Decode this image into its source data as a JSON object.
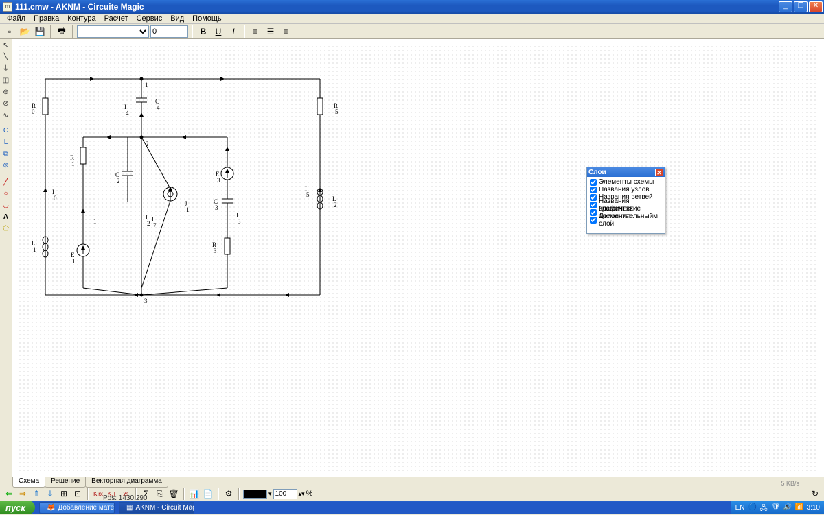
{
  "title": "111.cmw - AKNM - Circuite Magic",
  "menu": [
    "Файл",
    "Правка",
    "Контура",
    "Расчет",
    "Сервис",
    "Вид",
    "Помощь"
  ],
  "toolbar": {
    "font_value": "",
    "size_value": "0"
  },
  "layers": {
    "title": "Слои",
    "items": [
      "Элементы схемы",
      "Названия узлов",
      "Названия ветвей",
      "Названия элементов",
      "Графические элементы",
      "Дополнительныйм слой"
    ]
  },
  "tabs": {
    "t1": "Схема",
    "t2": "Решение",
    "t3": "Векторная диаграмма"
  },
  "bottom": {
    "zoom": "100",
    "pct": "%"
  },
  "status": {
    "pos": "Pos: 1430,290",
    "kbs": "5 KB/s"
  },
  "taskbar": {
    "start": "пуск",
    "task1": "Добавление матери...",
    "task2": "AKNM - Circuit Magic",
    "lang": "EN",
    "time": "3:10"
  },
  "labels": {
    "n1": "1",
    "n2": "2",
    "n3": "3",
    "R0": "R",
    "R0s": "0",
    "R1": "R",
    "R1s": "1",
    "R3": "R",
    "R3s": "3",
    "R5": "R",
    "R5s": "5",
    "L1": "L",
    "L1s": "1",
    "L2": "L",
    "L2s": "2",
    "C2": "C",
    "C2s": "2",
    "C3": "C",
    "C3s": "3",
    "C4": "C",
    "C4s": "4",
    "E1": "E",
    "E1s": "1",
    "E3": "E",
    "E3s": "3",
    "J1": "J",
    "J1s": "1",
    "I0": "I",
    "I0s": "0",
    "I1": "I",
    "I1s": "1",
    "I2": "I",
    "I2s": "2",
    "I3": "I",
    "I3s": "3",
    "I4": "I",
    "I4s": "4",
    "I5": "I",
    "I5s": "5",
    "I7": "I",
    "I7s": "7"
  }
}
